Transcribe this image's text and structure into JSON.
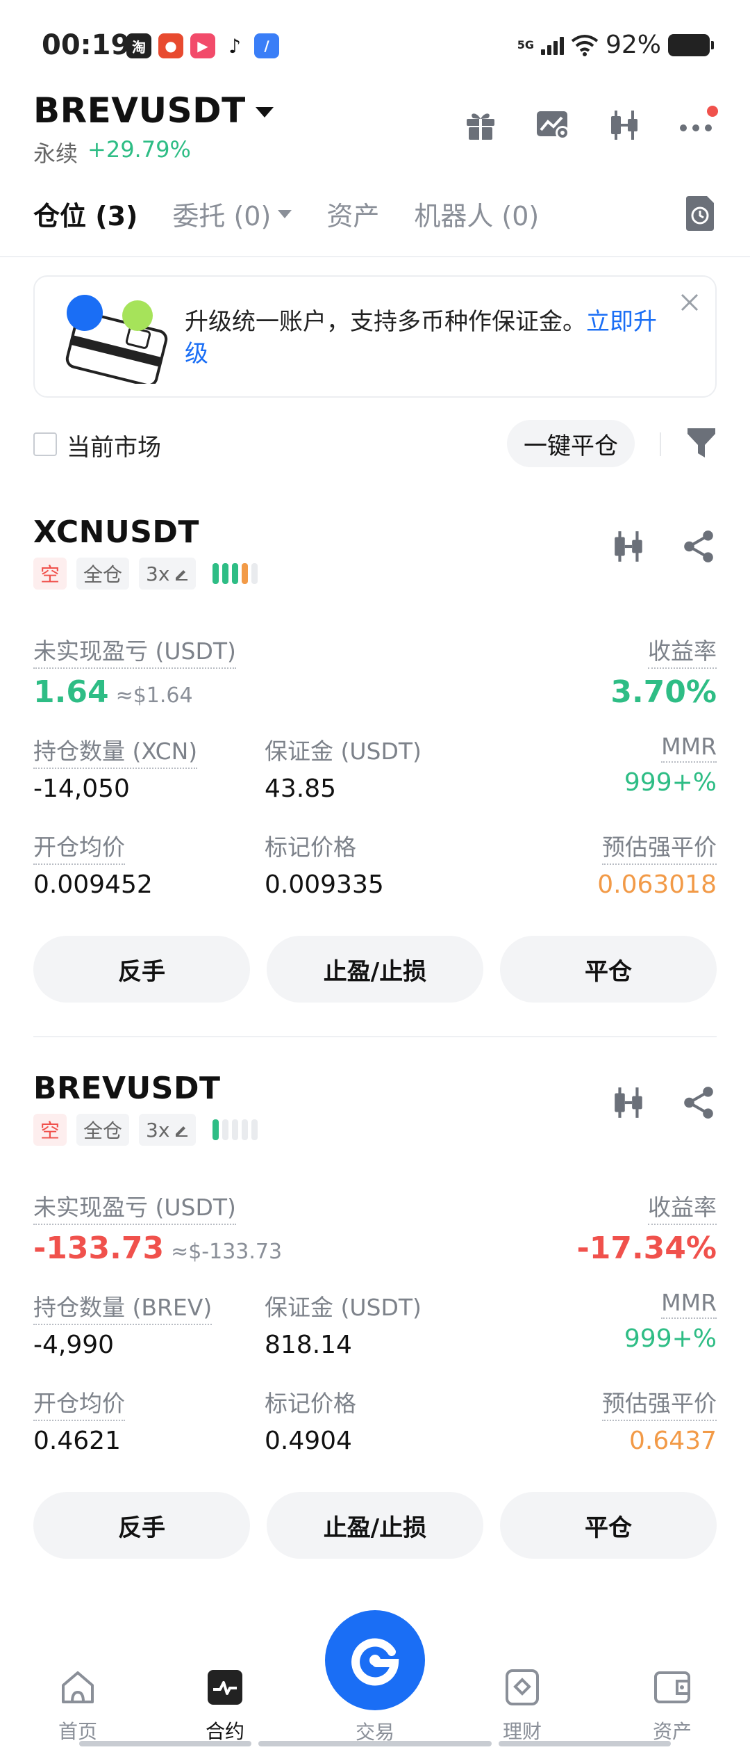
{
  "status_bar": {
    "time": "00:19",
    "network": "5G",
    "battery": "92%",
    "app_icons": [
      "taobao-icon",
      "app-red-icon",
      "video-app-icon",
      "tiktok-icon",
      "app-blue-icon"
    ]
  },
  "header": {
    "symbol": "BREVUSDT",
    "contract_type": "永续",
    "change": "+29.79%",
    "icons": [
      "gift-icon",
      "chart-settings-icon",
      "candlestick-icon",
      "more-icon"
    ]
  },
  "tabs": [
    {
      "label": "仓位 (3)"
    },
    {
      "label": "委托 (0)"
    },
    {
      "label": "资产"
    },
    {
      "label": "机器人 (0)"
    }
  ],
  "banner": {
    "text": "升级统一账户，支持多币种作保证金。",
    "link": "立即升级"
  },
  "filter": {
    "current_market_label": "当前市场",
    "close_all_label": "一键平仓"
  },
  "labels": {
    "unrealized_pnl": "未实现盈亏 (USDT)",
    "roe": "收益率",
    "margin": "保证金 (USDT)",
    "mmr": "MMR",
    "entry_price": "开仓均价",
    "mark_price": "标记价格",
    "liq_price": "预估强平价",
    "btn_reverse": "反手",
    "btn_tpsl": "止盈/止损",
    "btn_close": "平仓"
  },
  "positions": [
    {
      "symbol": "XCNUSDT",
      "side": "空",
      "margin_mode": "全仓",
      "leverage": "3x",
      "adl_level": 4,
      "unrealized_pnl": "1.64",
      "pnl_usd": "≈$1.64",
      "roe": "3.70%",
      "size_label": "持仓数量 (XCN)",
      "size": "-14,050",
      "margin": "43.85",
      "mmr": "999+%",
      "entry_price": "0.009452",
      "mark_price": "0.009335",
      "liq_price": "0.063018"
    },
    {
      "symbol": "BREVUSDT",
      "side": "空",
      "margin_mode": "全仓",
      "leverage": "3x",
      "adl_level": 1,
      "unrealized_pnl": "-133.73",
      "pnl_usd": "≈$-133.73",
      "roe": "-17.34%",
      "size_label": "持仓数量 (BREV)",
      "size": "-4,990",
      "margin": "818.14",
      "mmr": "999+%",
      "entry_price": "0.4621",
      "mark_price": "0.4904",
      "liq_price": "0.6437"
    }
  ],
  "bottom_nav": [
    {
      "label": "首页",
      "icon": "home-icon"
    },
    {
      "label": "合约",
      "icon": "futures-icon"
    },
    {
      "label": "交易",
      "icon": "trade-icon"
    },
    {
      "label": "理财",
      "icon": "earn-icon"
    },
    {
      "label": "资产",
      "icon": "wallet-icon"
    }
  ],
  "colors": {
    "profit": "#2ebd85",
    "loss": "#f0514c",
    "liquidation": "#f29a47",
    "accent": "#1a6ef5"
  }
}
